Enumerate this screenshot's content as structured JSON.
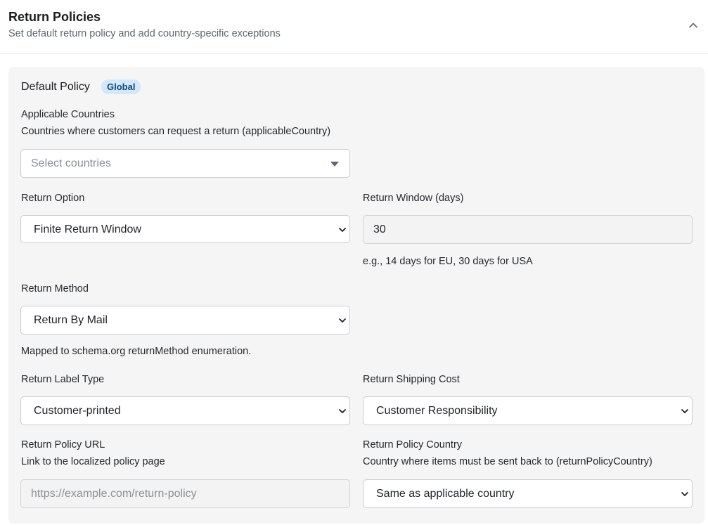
{
  "header": {
    "title": "Return Policies",
    "subtitle": "Set default return policy and add country-specific exceptions"
  },
  "policy": {
    "title": "Default Policy",
    "badge": "Global",
    "applicable_countries": {
      "label": "Applicable Countries",
      "description": "Countries where customers can request a return (applicableCountry)",
      "placeholder": "Select countries"
    },
    "return_option": {
      "label": "Return Option",
      "value": "Finite Return Window"
    },
    "return_window": {
      "label": "Return Window (days)",
      "value": "30",
      "help": "e.g., 14 days for EU, 30 days for USA"
    },
    "return_method": {
      "label": "Return Method",
      "value": "Return By Mail",
      "help": "Mapped to schema.org returnMethod enumeration."
    },
    "return_label_type": {
      "label": "Return Label Type",
      "value": "Customer-printed"
    },
    "return_shipping_cost": {
      "label": "Return Shipping Cost",
      "value": "Customer Responsibility"
    },
    "return_policy_url": {
      "label": "Return Policy URL",
      "description": "Link to the localized policy page",
      "placeholder": "https://example.com/return-policy"
    },
    "return_policy_country": {
      "label": "Return Policy Country",
      "description": "Country where items must be sent back to (returnPolicyCountry)",
      "value": "Same as applicable country"
    }
  }
}
